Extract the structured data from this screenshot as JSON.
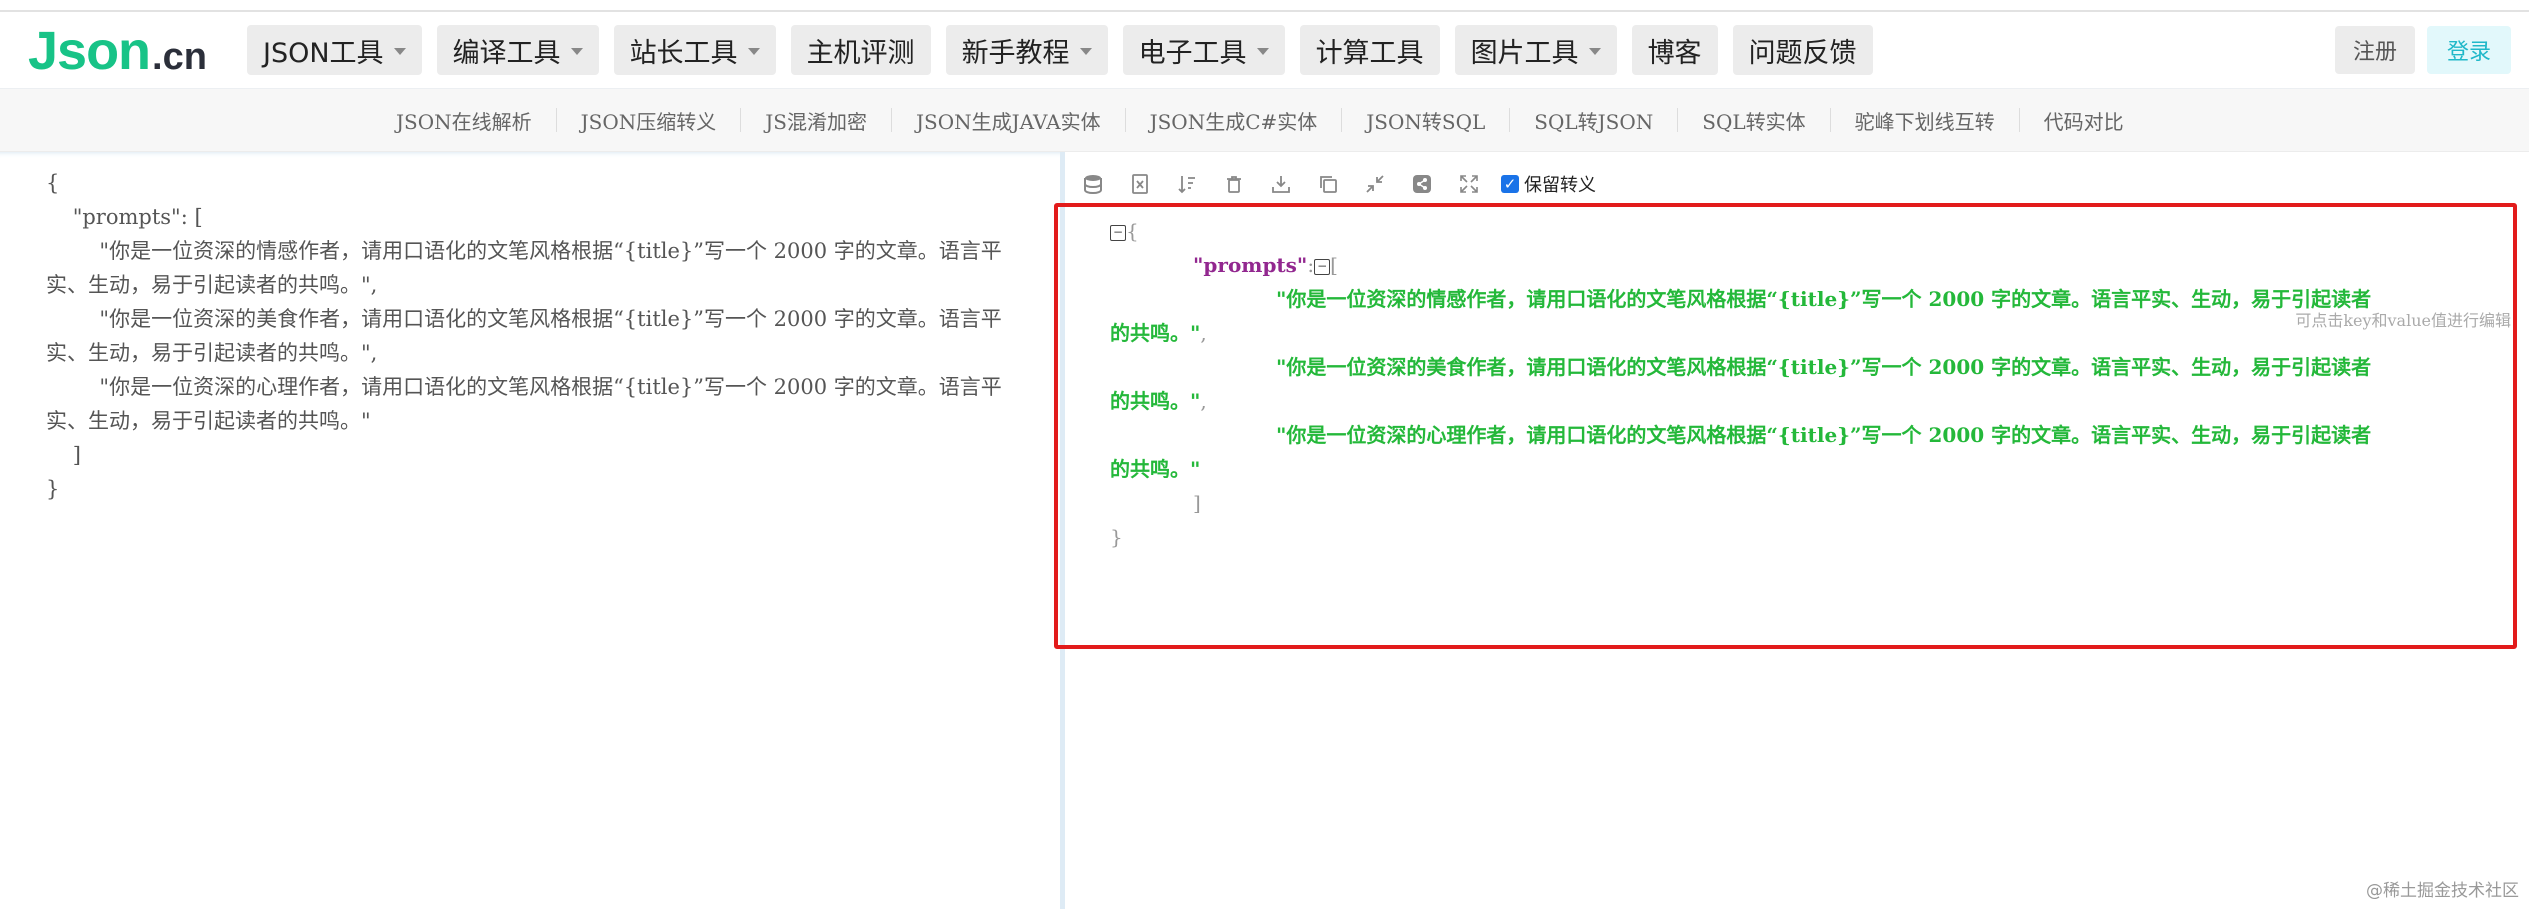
{
  "logo": {
    "big": "Json",
    "small": ".cn"
  },
  "nav": [
    {
      "label": "JSON工具",
      "dropdown": true
    },
    {
      "label": "编译工具",
      "dropdown": true
    },
    {
      "label": "站长工具",
      "dropdown": true
    },
    {
      "label": "主机评测",
      "dropdown": false
    },
    {
      "label": "新手教程",
      "dropdown": true
    },
    {
      "label": "电子工具",
      "dropdown": true
    },
    {
      "label": "计算工具",
      "dropdown": false
    },
    {
      "label": "图片工具",
      "dropdown": true
    },
    {
      "label": "博客",
      "dropdown": false
    },
    {
      "label": "问题反馈",
      "dropdown": false
    }
  ],
  "auth": {
    "register": "注册",
    "login": "登录"
  },
  "subnav": [
    "JSON在线解析",
    "JSON压缩转义",
    "JS混淆加密",
    "JSON生成JAVA实体",
    "JSON生成C#实体",
    "JSON转SQL",
    "SQL转JSON",
    "SQL转实体",
    "驼峰下划线互转",
    "代码对比"
  ],
  "editor": {
    "text": "{\n    \"prompts\": [\n        \"你是一位资深的情感作者，请用口语化的文笔风格根据“{title}”写一个 2000 字的文章。语言平实、生动，易于引起读者的共鸣。\",\n        \"你是一位资深的美食作者，请用口语化的文笔风格根据“{title}”写一个 2000 字的文章。语言平实、生动，易于引起读者的共鸣。\",\n        \"你是一位资深的心理作者，请用口语化的文笔风格根据“{title}”写一个 2000 字的文章。语言平实、生动，易于引起读者的共鸣。\"\n    ]\n}"
  },
  "toolbar": {
    "icons": [
      "database-icon",
      "excel-icon",
      "sort-icon",
      "trash-icon",
      "download-icon",
      "copy-icon",
      "compress-icon",
      "share-icon",
      "expand-icon"
    ],
    "keep_escape_label": "保留转义",
    "keep_escape_checked": true
  },
  "result": {
    "open_brace": "{",
    "key": "\"prompts\"",
    "colon": ":",
    "open_bracket": "[",
    "items": [
      {
        "line1": "\"你是一位资深的情感作者，请用口语化的文笔风格根据“{title}”写一个  2000  字的文章。语言平实、生动，易于引起读者",
        "line2": "的共鸣。\"",
        "comma": ","
      },
      {
        "line1": "\"你是一位资深的美食作者，请用口语化的文笔风格根据“{title}”写一个  2000  字的文章。语言平实、生动，易于引起读者",
        "line2": "的共鸣。\"",
        "comma": ","
      },
      {
        "line1": "\"你是一位资深的心理作者，请用口语化的文笔风格根据“{title}”写一个  2000  字的文章。语言平实、生动，易于引起读者",
        "line2": "的共鸣。\"",
        "comma": ""
      }
    ],
    "close_bracket": "]",
    "close_brace": "}",
    "edit_hint": "可点击key和value值进行编辑",
    "highlight_color": "#e21b1b"
  },
  "footer": {
    "watermark": "@稀土掘金技术社区"
  },
  "colors": {
    "brand": "#18c387",
    "key": "#92278f",
    "string": "#24b83a",
    "login": "#20b8c9"
  }
}
